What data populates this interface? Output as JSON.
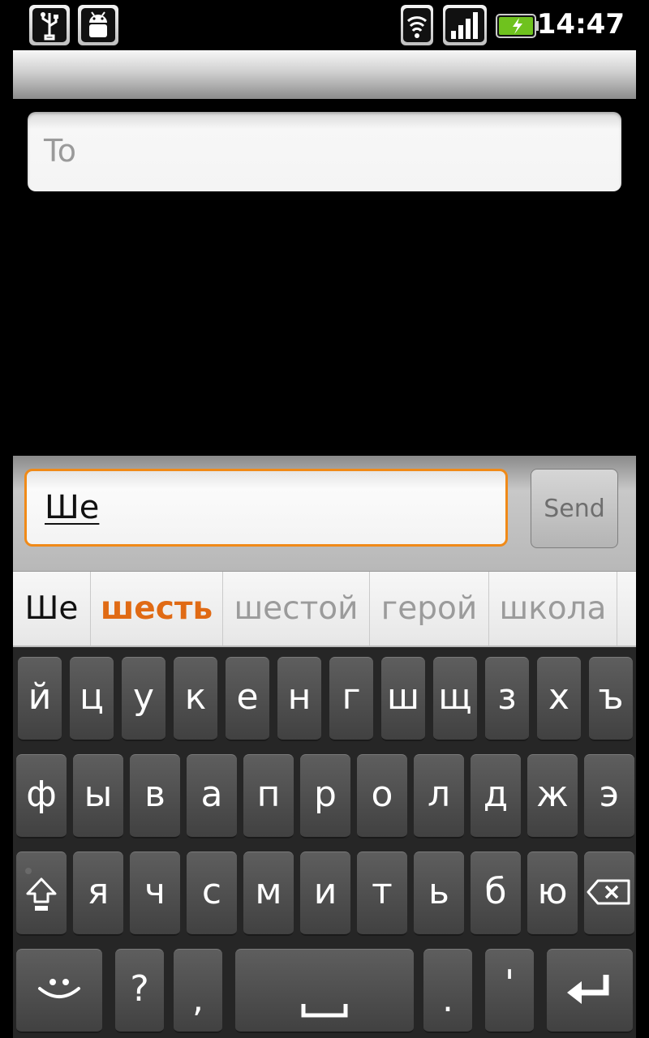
{
  "status_bar": {
    "time": "14:47",
    "left_icons": [
      "usb-icon",
      "android-debug-icon"
    ],
    "right_icons": [
      "wifi-icon",
      "signal-icon",
      "battery-charging-icon"
    ]
  },
  "recipient": {
    "placeholder": "To"
  },
  "compose": {
    "text": "Ше",
    "send_label": "Send"
  },
  "suggestions": {
    "typed": "Ше",
    "items": [
      "шесть",
      "шестой",
      "герой",
      "школа"
    ]
  },
  "keyboard": {
    "row1": [
      "й",
      "ц",
      "у",
      "к",
      "е",
      "н",
      "г",
      "ш",
      "щ",
      "з",
      "х",
      "ъ"
    ],
    "row2": [
      "ф",
      "ы",
      "в",
      "а",
      "п",
      "р",
      "о",
      "л",
      "д",
      "ж",
      "э"
    ],
    "row3": [
      "я",
      "ч",
      "с",
      "м",
      "и",
      "т",
      "ь",
      "б",
      "ю"
    ],
    "row4": {
      "question": "?",
      "comma": ",",
      "period": ".",
      "apostrophe": "'"
    },
    "special_icons": [
      "shift-icon",
      "backspace-icon",
      "smiley-icon",
      "space-icon",
      "enter-icon"
    ]
  },
  "colors": {
    "accent_orange": "#f08a18",
    "suggestion_highlight": "#e06a14",
    "key_bg": "#4a4a4a"
  }
}
